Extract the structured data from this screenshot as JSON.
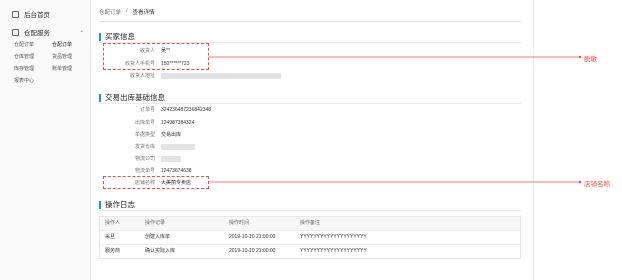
{
  "sidebar": {
    "home_label": "后台首页",
    "group_label": "仓配服务",
    "items": [
      "仓配订单",
      "仓配订单",
      "仓库管理",
      "货品管理",
      "库存管理",
      "账单管理",
      "报表中心"
    ]
  },
  "breadcrumb": {
    "parent": "仓配订单",
    "separator": "/",
    "current": "查看详情"
  },
  "buyer": {
    "title": "买家信息",
    "name_label": "收货人",
    "name_value": "吴**",
    "phone_label": "收货人手机号",
    "phone_value": "150******723",
    "address_label": "收货人地址"
  },
  "basic": {
    "title": "交易出库基础信息",
    "rows": [
      {
        "label": "订单号",
        "value": "324236487236842348"
      },
      {
        "label": "出库单号",
        "value": "124987384324"
      },
      {
        "label": "单据类型",
        "value": "交易出库"
      },
      {
        "label": "发货仓库",
        "value": ""
      },
      {
        "label": "物流公司",
        "value": ""
      },
      {
        "label": "物流单号",
        "value": "12473674638"
      },
      {
        "label": "店铺名称",
        "value": "大美丽专卖店"
      }
    ]
  },
  "log": {
    "title": "操作日志",
    "headers": [
      "操作人",
      "操作记录",
      "操作时间",
      "操作备注"
    ],
    "rows": [
      [
        "采旦",
        "创建入库单",
        "2019-10-10 21:00:00",
        "YYYYYYYYYYYYYYYYYYYY"
      ],
      [
        "服务商",
        "确认实际入库",
        "2019-10-10 21:00:00",
        "YYYYYYYYYYYYYYYYYYYY"
      ]
    ]
  },
  "annotations": {
    "mask": "脱敏",
    "shop": "店铺名称"
  },
  "colors": {
    "accent": "#1890ff",
    "annotation": "#f04e4e"
  }
}
